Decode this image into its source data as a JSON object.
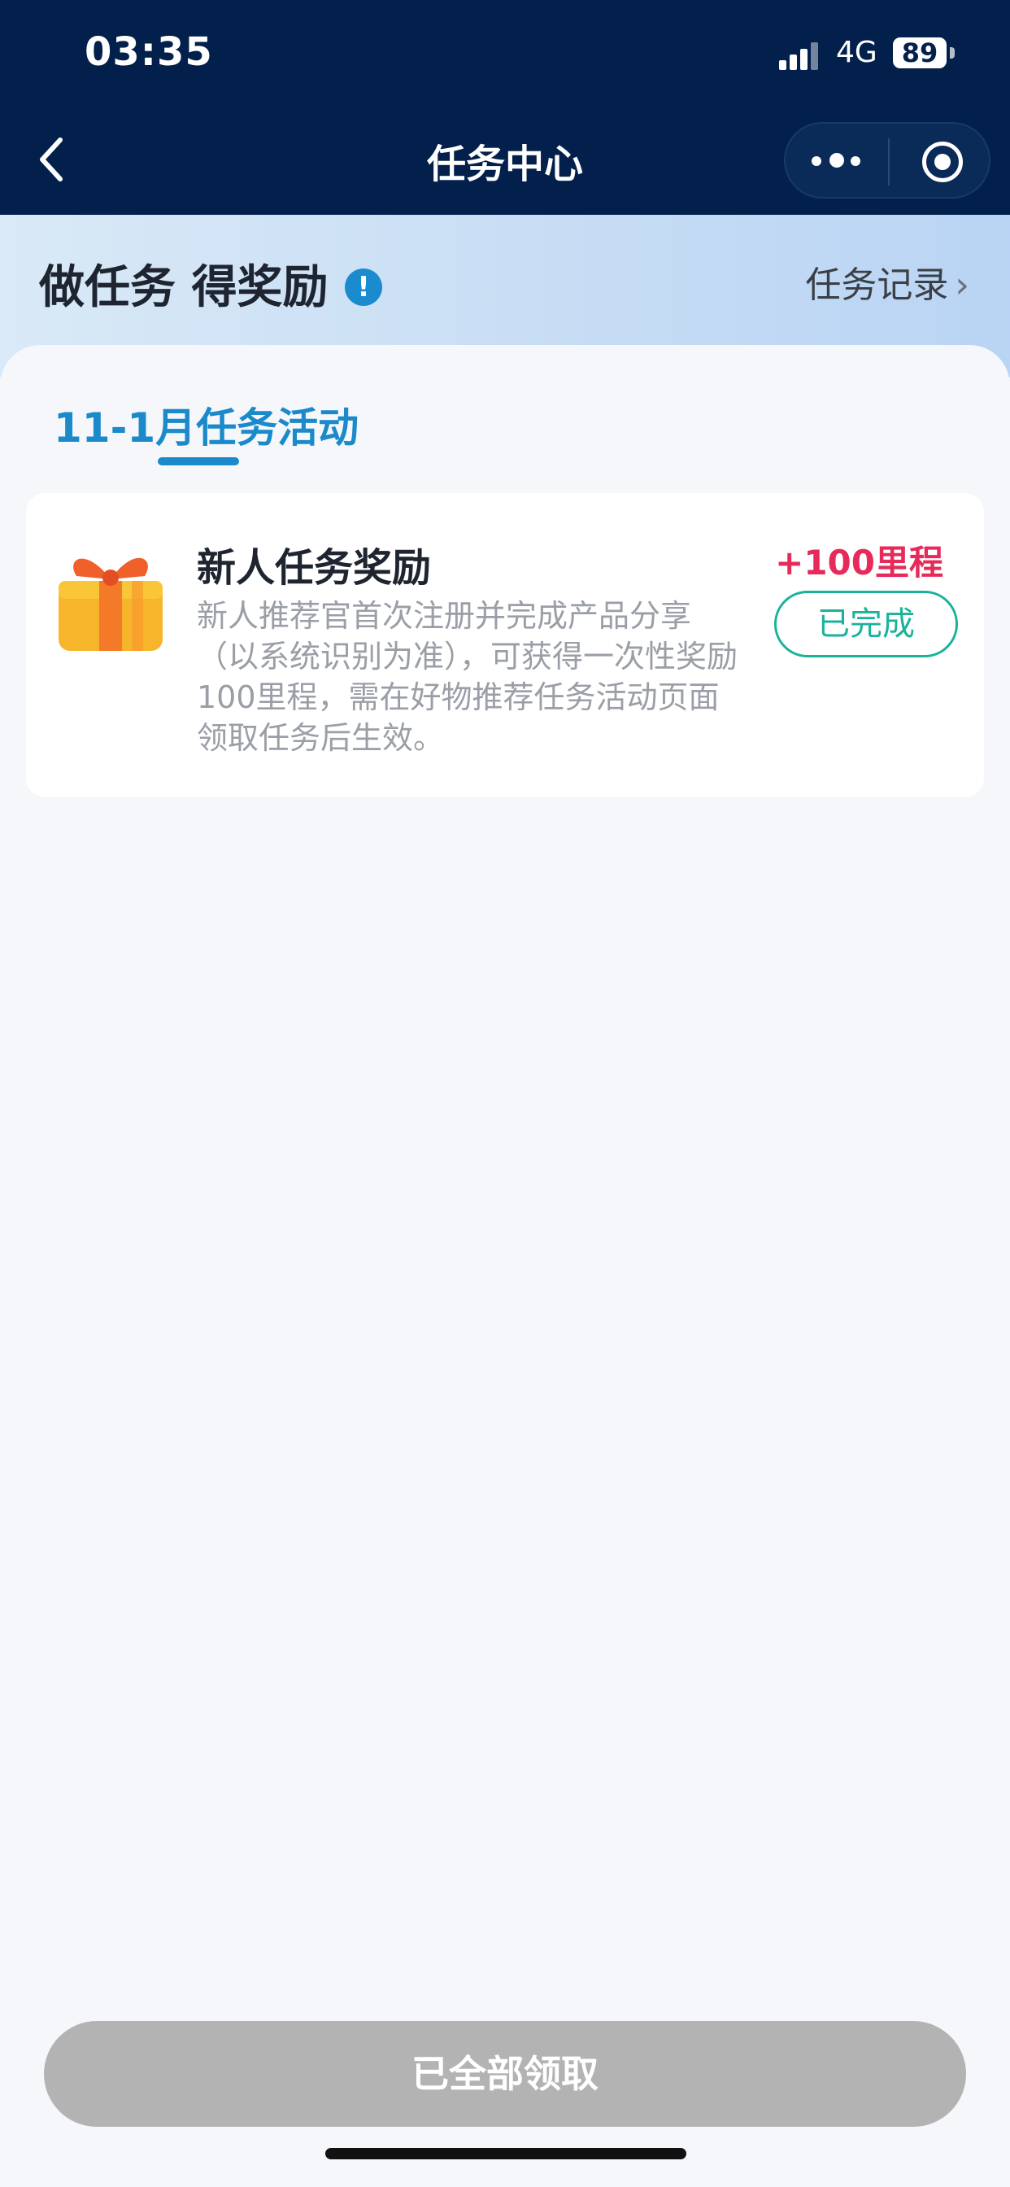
{
  "status_bar": {
    "time": "03:35",
    "network": "4G",
    "battery": "89"
  },
  "nav": {
    "title": "任务中心"
  },
  "banner": {
    "title": "做任务 得奖励",
    "info_mark": "!",
    "records_label": "任务记录",
    "records_chevron": "›"
  },
  "tabs": [
    {
      "label": "11-1月任务活动",
      "active": true
    }
  ],
  "tasks": [
    {
      "title": "新人任务奖励",
      "description": "新人推荐官首次注册并完成产品分享（以系统识别为准），可获得一次性奖励100里程，需在好物推荐任务活动页面领取任务后生效。",
      "reward": "+100里程",
      "status": "已完成",
      "icon": "gift-icon"
    }
  ],
  "footer": {
    "claim_all_label": "已全部领取"
  },
  "colors": {
    "nav_bg": "#02204b",
    "accent": "#1a8acb",
    "reward": "#e62a5a",
    "completed": "#18b39a",
    "disabled_button": "#b3b3b3"
  }
}
